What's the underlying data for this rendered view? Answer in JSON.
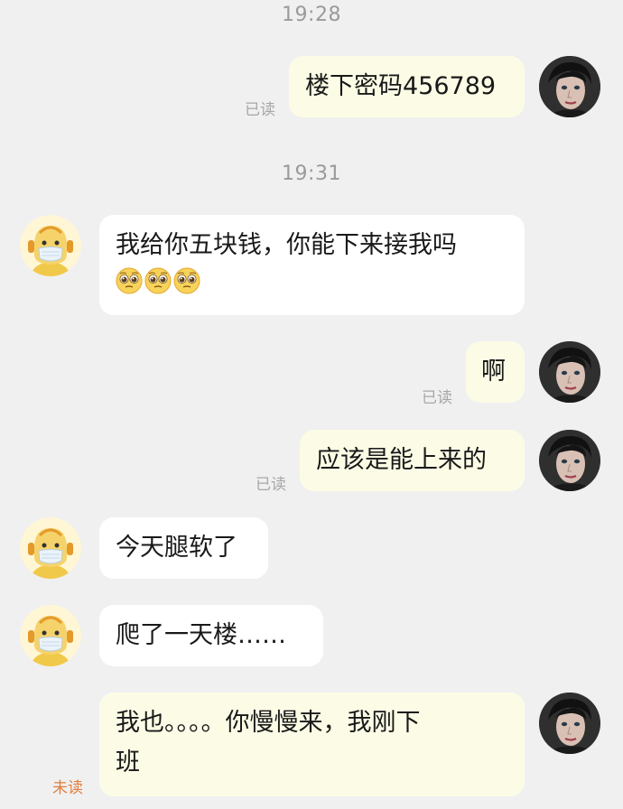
{
  "time1": "19:28",
  "time2": "19:31",
  "messages": [
    {
      "text": "楼下密码456789",
      "status": "已读"
    },
    {
      "text": "我给你五块钱，你能下来接我吗",
      "emoji": "pleading-face x3"
    },
    {
      "text": "啊",
      "status": "已读"
    },
    {
      "text": "应该是能上来的",
      "status": "已读"
    },
    {
      "text": "今天腿软了"
    },
    {
      "text": "爬了一天楼……"
    },
    {
      "line1": "我也。。。。你慢慢来，我刚下",
      "line2": "班",
      "status": "未读"
    }
  ],
  "colors": {
    "background": "#f0f0f0",
    "my_bubble": "#fcfce6",
    "other_bubble": "#ffffff",
    "unread": "#e07e3c",
    "read": "#a7a7a7"
  },
  "icons": [
    "my-avatar",
    "friend-avatar",
    "pleading-face-emoji"
  ]
}
